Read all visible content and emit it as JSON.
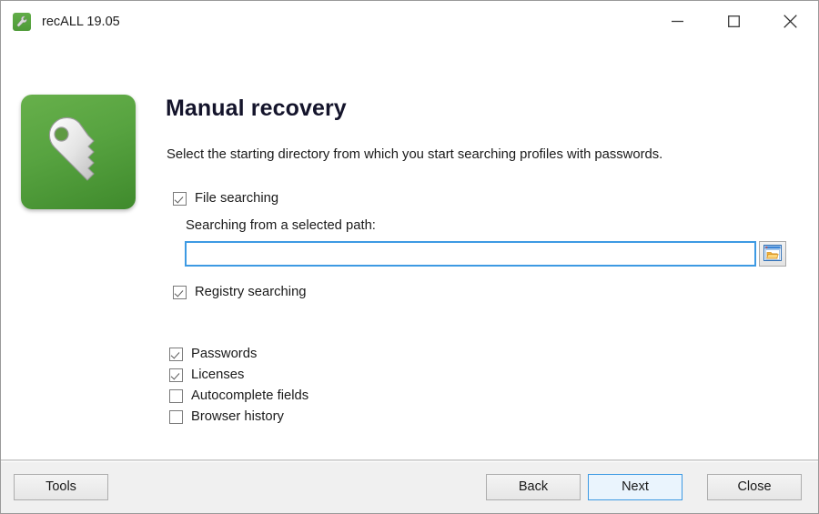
{
  "window": {
    "title": "recALL 19.05",
    "app_icon": "wrench-icon",
    "controls": {
      "minimize": "minimize-icon",
      "maximize": "maximize-icon",
      "close": "close-icon"
    }
  },
  "main": {
    "hero_icon": "key-icon",
    "title": "Manual recovery",
    "description": "Select the starting directory from which you start searching profiles with passwords.",
    "options": [
      {
        "label": "File searching",
        "checked": true
      },
      {
        "label": "Registry searching",
        "checked": true
      },
      {
        "label": "Passwords",
        "checked": true
      },
      {
        "label": "Licenses",
        "checked": true
      },
      {
        "label": "Autocomplete fields",
        "checked": false
      },
      {
        "label": "Browser history",
        "checked": false
      }
    ],
    "path_field": {
      "label": "Searching from a selected path:",
      "value": "",
      "placeholder": "",
      "browse_icon": "folder-icon"
    }
  },
  "footer": {
    "tools_label": "Tools",
    "back_label": "Back",
    "next_label": "Next",
    "close_label": "Close"
  },
  "colors": {
    "accent_blue": "#3d9ae3",
    "default_button_fill": "#eaf4fd",
    "icon_green": "#4e9a38",
    "folder_orange": "#f5b33c",
    "footer_gray": "#f0f0f0"
  }
}
